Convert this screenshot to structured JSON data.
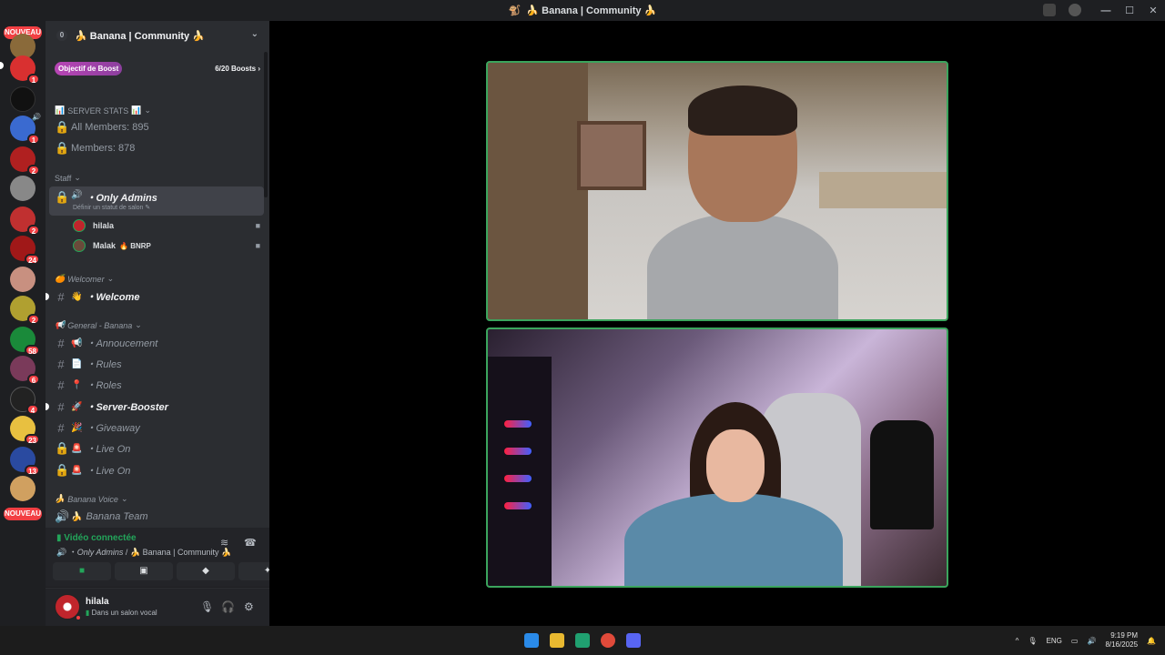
{
  "window": {
    "title": "🍌 Banana | Community 🍌",
    "controls": [
      "—",
      "☐",
      "✕"
    ]
  },
  "guilds": {
    "nouveau_top": "NOUVEAU",
    "nouveau_bottom": "NOUVEAU",
    "badges": [
      "1",
      "1",
      "2",
      "2",
      "24",
      "2",
      "58",
      "6",
      "4",
      "23",
      "13"
    ]
  },
  "sidebar": {
    "server_name": "🍌 Banana | Community 🍌",
    "zero": "0",
    "boost_label": "Objectif de Boost",
    "boost_count": "6/20 Boosts ›",
    "categories": {
      "stats": "SERVER STATS",
      "staff": "Staff",
      "welcomer": "Welcomer",
      "general": "General - Banana",
      "voice": "Banana Voice"
    },
    "stats": [
      "All Members: 895",
      "Members: 878"
    ],
    "active_channel": {
      "name": "・Only Admins",
      "sub": "Définir un statut de salon ✎"
    },
    "members": [
      {
        "name": "hilala",
        "tag": ""
      },
      {
        "name": "Malak",
        "tag": "🔥 BNRP"
      }
    ],
    "channels": [
      {
        "emoji": "👋",
        "name": "・Welcome",
        "bold": true
      },
      {
        "emoji": "📢",
        "name": "・Annoucement",
        "bold": false
      },
      {
        "emoji": "📄",
        "name": "・Rules",
        "bold": false
      },
      {
        "emoji": "📍",
        "name": "・Roles",
        "bold": false
      },
      {
        "emoji": "🚀",
        "name": "・Server-Booster",
        "bold": true
      },
      {
        "emoji": "🎉",
        "name": "・Giveaway",
        "bold": false
      },
      {
        "emoji": "🚨",
        "name": "・Live On",
        "bold": false
      },
      {
        "emoji": "🚨",
        "name": "・Live On",
        "bold": false
      }
    ],
    "voice_channel": {
      "emoji": "🍌",
      "name": "Banana Team"
    }
  },
  "voice_panel": {
    "title": "Vidéo connectée",
    "channel": "Only Admins",
    "server": "🍌 Banana | Community 🍌"
  },
  "user_panel": {
    "name": "hilala",
    "status": "Dans un salon vocal"
  },
  "taskbar": {
    "lang": "ENG",
    "time": "9:19 PM",
    "date": "8/16/2025"
  },
  "colors": {
    "accent_green": "#3ba55d",
    "sidebar_bg": "#2b2d31",
    "badge_red": "#f23f43"
  }
}
